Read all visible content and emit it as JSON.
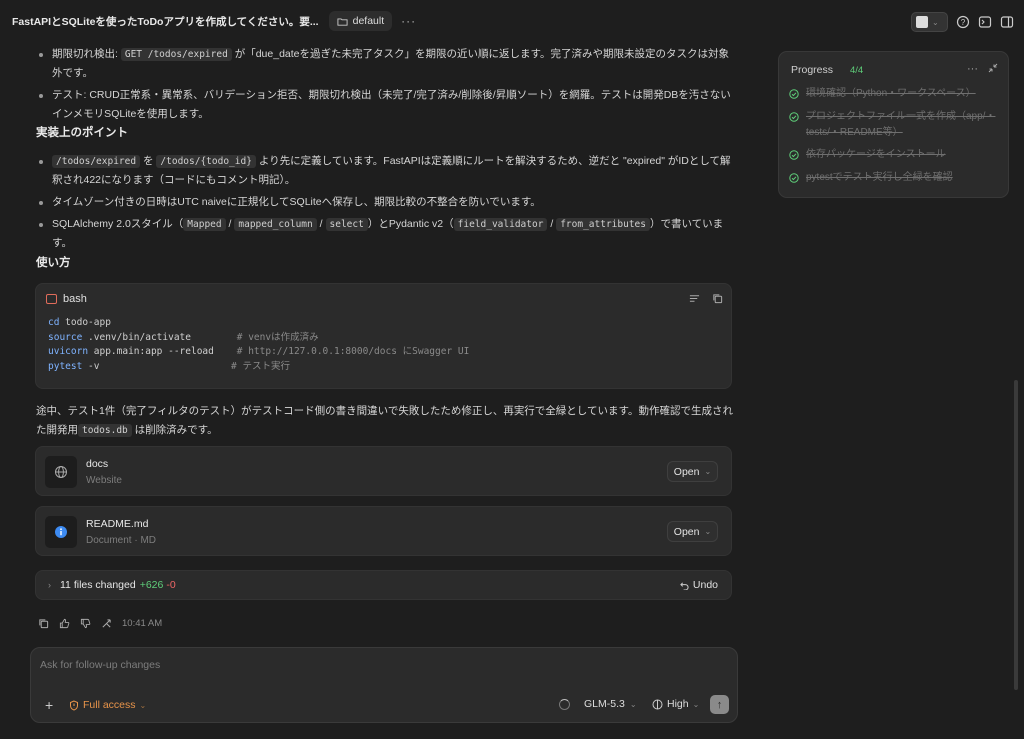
{
  "header": {
    "title": "FastAPIとSQLiteを使ったToDoアプリを作成してください。要...",
    "folder": "default",
    "more": "···"
  },
  "content": {
    "bullets_top": [
      {
        "parts": [
          "期限切れ検出: ",
          "GET /todos/expired",
          " が「due_dateを過ぎた未完了タスク」を期限の近い順に返します。完了済みや期限未設定のタスクは対象外です。"
        ]
      },
      {
        "parts": [
          "テスト: CRUD正常系・異常系、バリデーション拒否、期限切れ検出（未完了/完了済み/削除後/昇順ソート）を網羅。テストは開発DBを汚さないインメモリSQLiteを使用します。"
        ]
      }
    ],
    "heading_points": "実装上のポイント",
    "bullets_points": [
      {
        "parts": [
          "/todos/expired",
          " を ",
          "/todos/{todo_id}",
          " より先に定義しています。FastAPIは定義順にルートを解決するため、逆だと \"expired\" がIDとして解釈され422になります（コードにもコメント明記）。"
        ]
      },
      {
        "parts": [
          "タイムゾーン付きの日時はUTC naiveに正規化してSQLiteへ保存し、期限比較の不整合を防いでいます。"
        ]
      },
      {
        "parts": [
          "SQLAlchemy 2.0スタイル（",
          "Mapped",
          " / ",
          "mapped_column",
          " / ",
          "select",
          "）とPydantic v2（",
          "field_validator",
          " / ",
          "from_attributes",
          "）で書いています。"
        ]
      }
    ],
    "heading_usage": "使い方",
    "code": {
      "lang": "bash",
      "lines": [
        {
          "cmd": "cd",
          "rest": " todo-app",
          "comment": ""
        },
        {
          "cmd": "source",
          "rest": " .venv/bin/activate       ",
          "comment": " # venvは作成済み"
        },
        {
          "cmd": "uvicorn",
          "rest": " app.main:app --reload   ",
          "comment": " # http://127.0.0.1:8000/docs にSwagger UI"
        },
        {
          "cmd": "pytest",
          "rest": " -v                      ",
          "comment": " # テスト実行"
        }
      ]
    },
    "note_parts": [
      "途中、テスト1件（完了フィルタのテスト）がテストコード側の書き間違いで失敗したため修正し、再実行で全緑としています。動作確認で生成された開発用",
      "todos.db",
      " は削除済みです。"
    ],
    "cards": [
      {
        "title": "docs",
        "subtitle": "Website",
        "button": "Open",
        "icon": "globe-icon"
      },
      {
        "title": "README.md",
        "subtitle": "Document · MD",
        "button": "Open",
        "icon": "info-icon"
      }
    ],
    "files_changed": {
      "label": "11 files changed",
      "added": "+626",
      "removed": "-0",
      "undo": "Undo"
    },
    "message_time": "10:41 AM"
  },
  "progress": {
    "title": "Progress",
    "count": "4/4",
    "tasks": [
      "環境確認（Python・ワークスペース）",
      "プロジェクトファイル一式を作成（app/・tests/・README等）",
      "依存パッケージをインストール",
      "pytestでテスト実行し全緑を確認"
    ]
  },
  "composer": {
    "placeholder": "Ask for follow-up changes",
    "access": "Full access",
    "model": "GLM-5.3",
    "effort": "High"
  },
  "colors": {
    "accent_green": "#5fcf7a",
    "accent_orange": "#e8944a",
    "removed_red": "#e66666"
  }
}
